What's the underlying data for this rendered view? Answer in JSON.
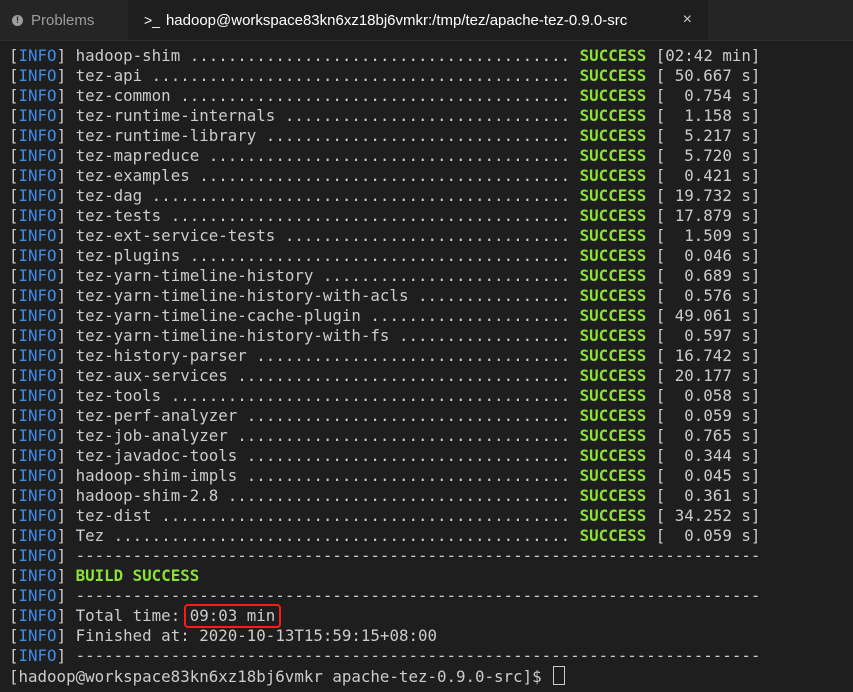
{
  "tabs": {
    "problems_label": "Problems",
    "terminal_label": "hadoop@workspace83kn6xz18bj6vmkr:/tmp/tez/apache-tez-0.9.0-src",
    "close_glyph": "×",
    "terminal_glyph": ">_"
  },
  "terminal": {
    "info_tag": "INFO",
    "success_word": "SUCCESS",
    "modules": [
      {
        "name": "hadoop-shim",
        "dots": " ........................................ ",
        "time": "[02:42 min]"
      },
      {
        "name": "tez-api",
        "dots": " ............................................ ",
        "time": "[ 50.667 s]"
      },
      {
        "name": "tez-common",
        "dots": " ......................................... ",
        "time": "[  0.754 s]"
      },
      {
        "name": "tez-runtime-internals",
        "dots": " .............................. ",
        "time": "[  1.158 s]"
      },
      {
        "name": "tez-runtime-library",
        "dots": " ................................ ",
        "time": "[  5.217 s]"
      },
      {
        "name": "tez-mapreduce",
        "dots": " ...................................... ",
        "time": "[  5.720 s]"
      },
      {
        "name": "tez-examples",
        "dots": " ....................................... ",
        "time": "[  0.421 s]"
      },
      {
        "name": "tez-dag",
        "dots": " ............................................ ",
        "time": "[ 19.732 s]"
      },
      {
        "name": "tez-tests",
        "dots": " .......................................... ",
        "time": "[ 17.879 s]"
      },
      {
        "name": "tez-ext-service-tests",
        "dots": " .............................. ",
        "time": "[  1.509 s]"
      },
      {
        "name": "tez-plugins",
        "dots": " ........................................ ",
        "time": "[  0.046 s]"
      },
      {
        "name": "tez-yarn-timeline-history",
        "dots": " .......................... ",
        "time": "[  0.689 s]"
      },
      {
        "name": "tez-yarn-timeline-history-with-acls",
        "dots": " ................ ",
        "time": "[  0.576 s]"
      },
      {
        "name": "tez-yarn-timeline-cache-plugin",
        "dots": " ..................... ",
        "time": "[ 49.061 s]"
      },
      {
        "name": "tez-yarn-timeline-history-with-fs",
        "dots": " .................. ",
        "time": "[  0.597 s]"
      },
      {
        "name": "tez-history-parser",
        "dots": " ................................. ",
        "time": "[ 16.742 s]"
      },
      {
        "name": "tez-aux-services",
        "dots": " ................................... ",
        "time": "[ 20.177 s]"
      },
      {
        "name": "tez-tools",
        "dots": " .......................................... ",
        "time": "[  0.058 s]"
      },
      {
        "name": "tez-perf-analyzer",
        "dots": " .................................. ",
        "time": "[  0.059 s]"
      },
      {
        "name": "tez-job-analyzer",
        "dots": " ................................... ",
        "time": "[  0.765 s]"
      },
      {
        "name": "tez-javadoc-tools",
        "dots": " .................................. ",
        "time": "[  0.344 s]"
      },
      {
        "name": "hadoop-shim-impls",
        "dots": " .................................. ",
        "time": "[  0.045 s]"
      },
      {
        "name": "hadoop-shim-2.8",
        "dots": " .................................... ",
        "time": "[  0.361 s]"
      },
      {
        "name": "tez-dist",
        "dots": " ........................................... ",
        "time": "[ 34.252 s]"
      },
      {
        "name": "Tez",
        "dots": " ................................................ ",
        "time": "[  0.059 s]"
      }
    ],
    "separator": " ------------------------------------------------------------------------",
    "build_result": "BUILD SUCCESS",
    "total_time_label": " Total time: ",
    "total_time_value": "09:03 min",
    "finished_label": " Finished at: ",
    "finished_value": "2020-10-13T15:59:15+08:00",
    "prompt": "[hadoop@workspace83kn6xz18bj6vmkr apache-tez-0.9.0-src]$ "
  }
}
